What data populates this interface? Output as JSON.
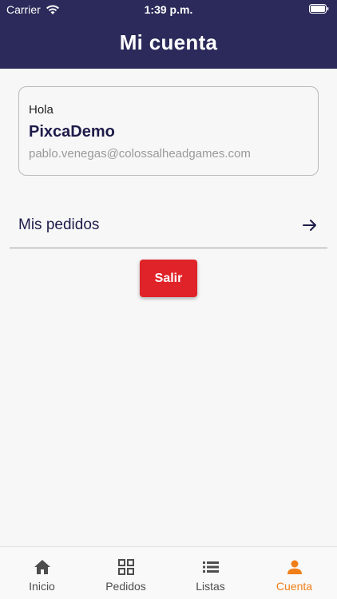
{
  "status_bar": {
    "carrier": "Carrier",
    "time": "1:39 p.m."
  },
  "header": {
    "title": "Mi cuenta"
  },
  "account": {
    "greeting": "Hola",
    "username": "PixcaDemo",
    "email": "pablo.venegas@colossalheadgames.com"
  },
  "orders": {
    "label": "Mis pedidos"
  },
  "logout": {
    "label": "Salir"
  },
  "bottom_nav": {
    "items": [
      {
        "label": "Inicio",
        "icon": "home-icon"
      },
      {
        "label": "Pedidos",
        "icon": "grid-icon"
      },
      {
        "label": "Listas",
        "icon": "list-icon"
      },
      {
        "label": "Cuenta",
        "icon": "person-icon",
        "active": true
      }
    ]
  },
  "colors": {
    "header_bg": "#2b2a5a",
    "accent_active": "#f07f19",
    "logout_bg": "#e02329",
    "text_dark": "#1e1c4a"
  }
}
